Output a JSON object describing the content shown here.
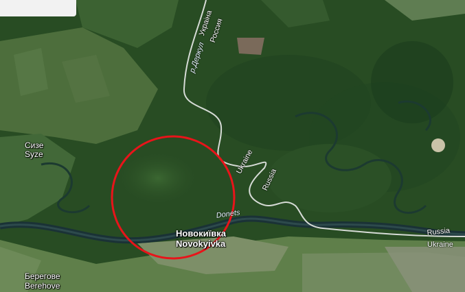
{
  "map": {
    "labels": {
      "syze_ru": "Сизе",
      "syze_en": "Syze",
      "novokyivka_ua": "Новокиївка",
      "novokyivka_en": "Novokyivka",
      "berehove_ua": "Берегове",
      "berehove_en": "Berehove",
      "donets": "Donets",
      "derkul": "р.Деркул",
      "ukraina_ru": "Украіна",
      "rossiya_ru": "Россия",
      "ukraine_mid": "Ukraine",
      "russia_mid": "Russia",
      "russia_right": "Russia",
      "ukraine_right": "Ukraine"
    },
    "colors": {
      "forest": "#274a22",
      "border": "#d8dcd8",
      "river": "#1f3a40",
      "highlight_circle": "#e8141a"
    }
  }
}
